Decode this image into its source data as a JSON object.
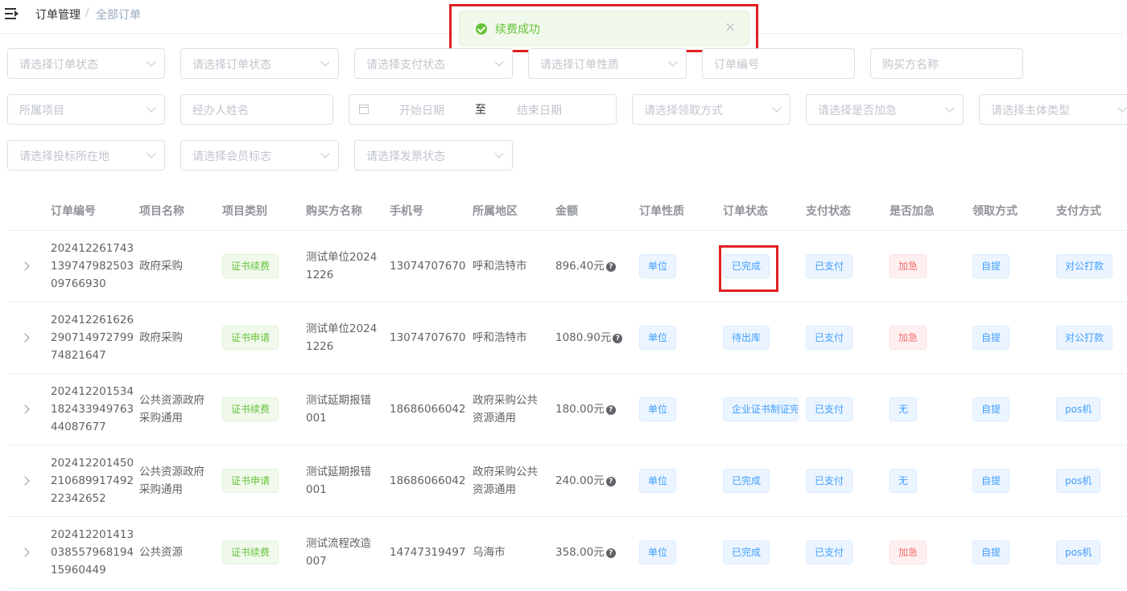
{
  "breadcrumb": {
    "item1": "订单管理",
    "sep": "/",
    "item2": "全部订单"
  },
  "toast": {
    "message": "续费成功",
    "close": "×",
    "icon": "check-circle-icon",
    "color": "#67c23a"
  },
  "filters": {
    "order_status_1": "请选择订单状态",
    "order_status_2": "请选择订单状态",
    "pay_status": "请选择支付状态",
    "order_nature": "请选择订单性质",
    "order_no": "订单编号",
    "buyer_name": "购买方名称",
    "project": "所属项目",
    "handler_name": "经办人姓名",
    "start_date": "开始日期",
    "date_to": "至",
    "end_date": "结束日期",
    "pickup_method": "请选择领取方式",
    "urgent": "请选择是否加急",
    "entity_type": "请选择主体类型",
    "bid_location": "请选择投标所在地",
    "member_flag": "请选择会员标志",
    "invoice_status": "请选择发票状态"
  },
  "table": {
    "headers": [
      "订单编号",
      "项目名称",
      "项目类别",
      "购买方名称",
      "手机号",
      "所属地区",
      "金额",
      "订单性质",
      "订单状态",
      "支付状态",
      "是否加急",
      "领取方式",
      "支付方式"
    ],
    "rows": [
      {
        "order_no": [
          "202412261743",
          "139747982503",
          "09766930"
        ],
        "project": [
          "政府采购"
        ],
        "category": "证书续费",
        "buyer": [
          "测试单位2024",
          "1226"
        ],
        "phone": "13074707670",
        "region": [
          "呼和浩特市"
        ],
        "amount": "896.40元",
        "nature": "单位",
        "status": "已完成",
        "pay_status": "已支付",
        "urgent": "加急",
        "pickup": "自提",
        "pay_method": "对公打款"
      },
      {
        "order_no": [
          "202412261626",
          "290714972799",
          "74821647"
        ],
        "project": [
          "政府采购"
        ],
        "category": "证书申请",
        "buyer": [
          "测试单位2024",
          "1226"
        ],
        "phone": "13074707670",
        "region": [
          "呼和浩特市"
        ],
        "amount": "1080.90元",
        "nature": "单位",
        "status": "待出库",
        "pay_status": "已支付",
        "urgent": "加急",
        "pickup": "自提",
        "pay_method": "对公打款"
      },
      {
        "order_no": [
          "202412201534",
          "182433949763",
          "44087677"
        ],
        "project": [
          "公共资源政府",
          "采购通用"
        ],
        "category": "证书续费",
        "buyer": [
          "测试延期报错",
          "001"
        ],
        "phone": "18686066042",
        "region": [
          "政府采购公共",
          "资源通用"
        ],
        "amount": "180.00元",
        "nature": "单位",
        "status": "企业证书制证完成",
        "pay_status": "已支付",
        "urgent": "无",
        "pickup": "自提",
        "pay_method": "pos机"
      },
      {
        "order_no": [
          "202412201450",
          "210689917492",
          "22342652"
        ],
        "project": [
          "公共资源政府",
          "采购通用"
        ],
        "category": "证书申请",
        "buyer": [
          "测试延期报错",
          "001"
        ],
        "phone": "18686066042",
        "region": [
          "政府采购公共",
          "资源通用"
        ],
        "amount": "240.00元",
        "nature": "单位",
        "status": "已完成",
        "pay_status": "已支付",
        "urgent": "无",
        "pickup": "自提",
        "pay_method": "pos机"
      },
      {
        "order_no": [
          "202412201413",
          "038557968194",
          "15960449"
        ],
        "project": [
          "公共资源"
        ],
        "category": "证书续费",
        "buyer": [
          "测试流程改造",
          "007"
        ],
        "phone": "14747319497",
        "region": [
          "乌海市"
        ],
        "amount": "358.00元",
        "nature": "单位",
        "status": "已完成",
        "pay_status": "已支付",
        "urgent": "加急",
        "pickup": "自提",
        "pay_method": "pos机"
      }
    ]
  }
}
